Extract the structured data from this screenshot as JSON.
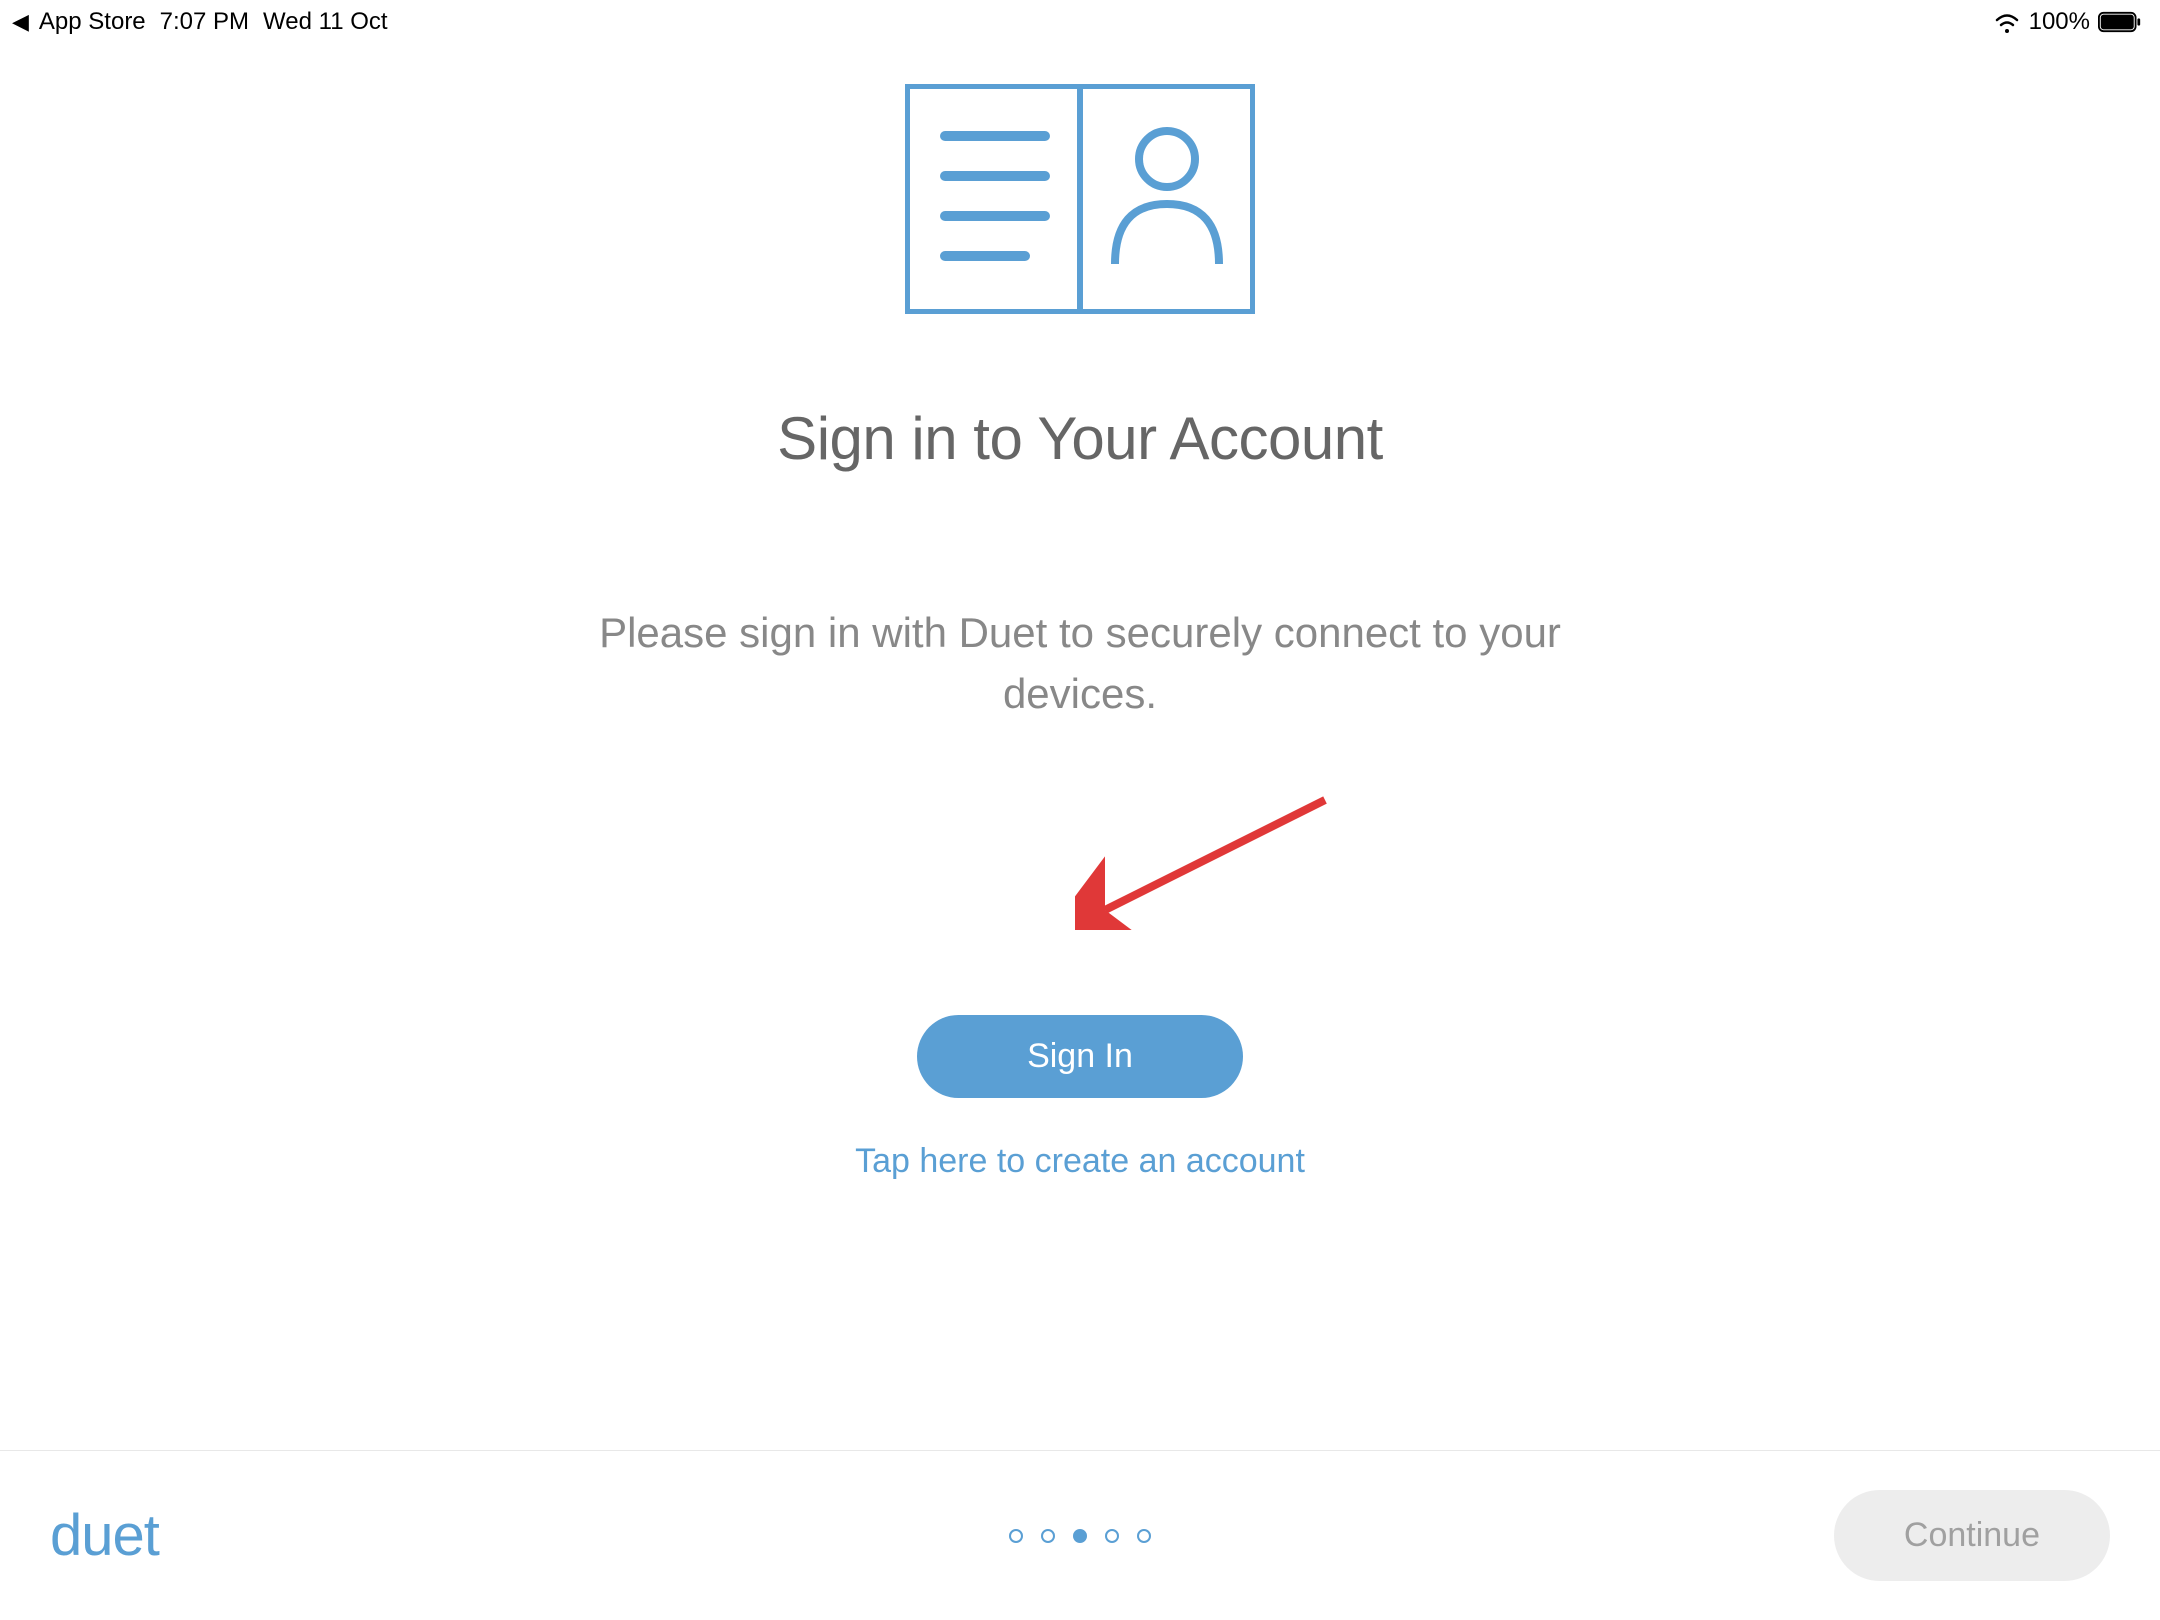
{
  "status_bar": {
    "back_label": "App Store",
    "time": "7:07 PM",
    "date": "Wed 11 Oct",
    "battery_percent": "100%"
  },
  "main": {
    "title": "Sign in to Your Account",
    "subtitle": "Please sign in with Duet to securely connect to your devices.",
    "sign_in_label": "Sign In",
    "create_account_label": "Tap here to create an account"
  },
  "footer": {
    "logo": "duet",
    "continue_label": "Continue",
    "page_count": 5,
    "current_page": 3
  },
  "colors": {
    "accent": "#5a9fd4",
    "text_primary": "#666666",
    "text_secondary": "#888888",
    "annotation": "#e03838"
  }
}
